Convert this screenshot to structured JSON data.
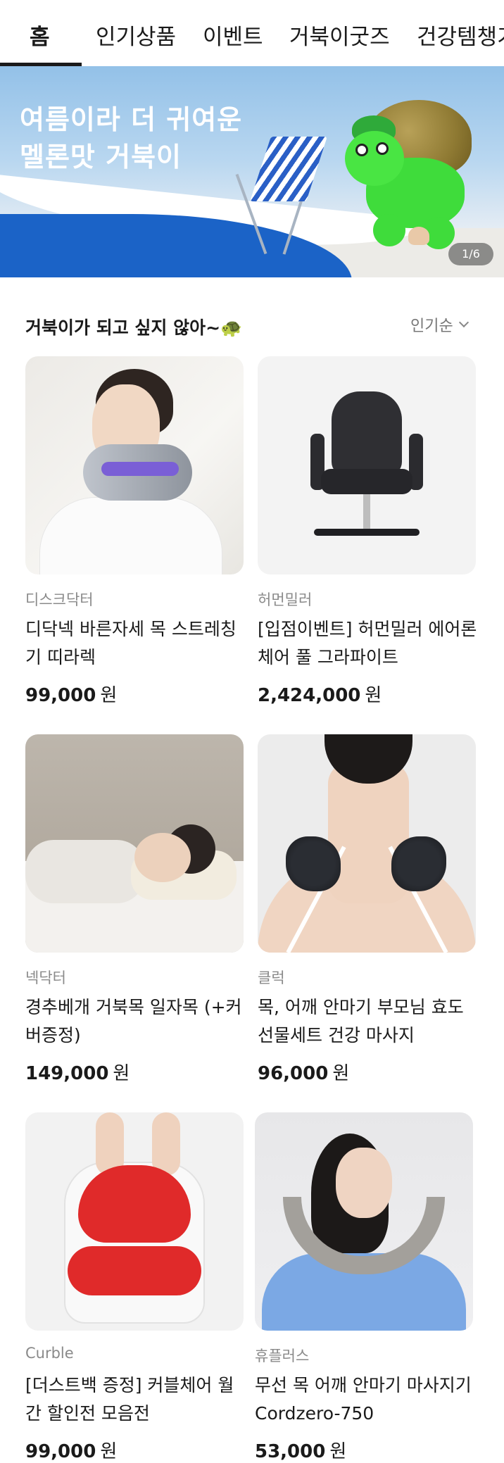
{
  "tabs": {
    "items": [
      {
        "label": "홈"
      },
      {
        "label": "인기상품"
      },
      {
        "label": "이벤트"
      },
      {
        "label": "거북이굿즈"
      },
      {
        "label": "건강템챙기"
      }
    ],
    "active_index": 0
  },
  "banner": {
    "line1": "여름이라 더 귀여운",
    "line2": "멜론맛 거북이",
    "pager": "1/6"
  },
  "section": {
    "title": "거북이가 되고 싶지 않아~🐢",
    "sort_label": "인기순",
    "sort_icon": "chevron-down-icon"
  },
  "products": [
    {
      "brand": "디스크닥터",
      "title": "디닥넥 바른자세 목 스트레칭기 띠라렉",
      "price": "99,000",
      "currency": "원"
    },
    {
      "brand": "허먼밀러",
      "title": "[입점이벤트] 허먼밀러 에어론 체어 풀 그라파이트",
      "price": "2,424,000",
      "currency": "원"
    },
    {
      "brand": "넥닥터",
      "title": "경추베개 거북목 일자목 (+커버증정)",
      "price": "149,000",
      "currency": "원"
    },
    {
      "brand": "클럭",
      "title": "목, 어깨 안마기 부모님 효도 선물세트 건강 마사지",
      "price": "96,000",
      "currency": "원"
    },
    {
      "brand": "Curble",
      "title": "[더스트백 증정] 커블체어 월간 할인전 모음전",
      "price": "99,000",
      "currency": "원"
    },
    {
      "brand": "휴플러스",
      "title": "무선 목 어깨 안마기 마사지기 Cordzero-750",
      "price": "53,000",
      "currency": "원"
    }
  ]
}
